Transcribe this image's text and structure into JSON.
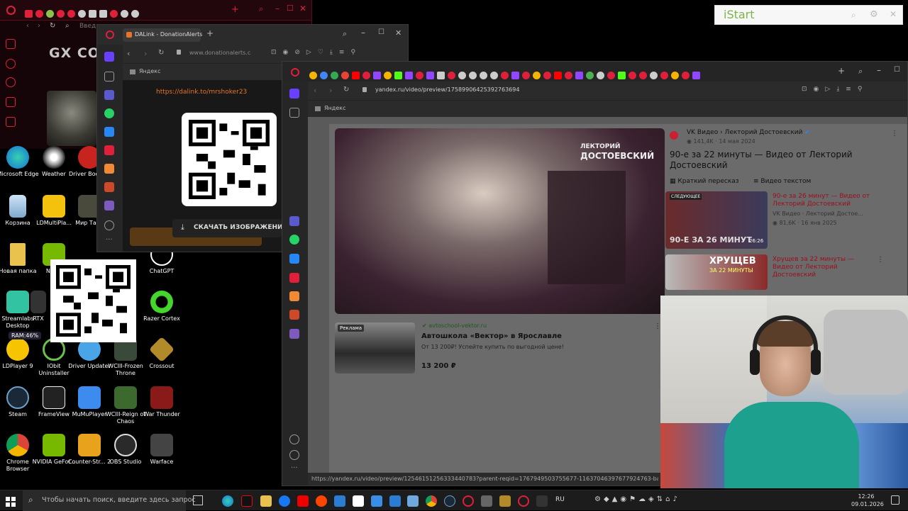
{
  "colors": {
    "opera_red": "#e0203a",
    "accent_orange": "#e8742a",
    "brand_red": "#cc1f2f",
    "vk_blue": "#2787f5"
  },
  "gx_window": {
    "title_text": "GX CO",
    "address_placeholder": "Введ"
  },
  "istart": {
    "label": "iStart"
  },
  "desktop_icons": [
    {
      "label": "Microsoft Edge"
    },
    {
      "label": "Weather"
    },
    {
      "label": "Driver Booster"
    },
    {
      "label": "Корзина"
    },
    {
      "label": "LDMultiPla..."
    },
    {
      "label": "Мир Танк"
    },
    {
      "label": "Новая папка"
    },
    {
      "label": "NVIDI"
    },
    {
      "label": "ChatGPT"
    },
    {
      "label": "Streamlabs Desktop"
    },
    {
      "label": "RTX"
    },
    {
      "label": "Razer Cortex"
    },
    {
      "label": "LDPlayer 9"
    },
    {
      "label": "IObit Uninstaller"
    },
    {
      "label": "Driver Updater"
    },
    {
      "label": "WCIII-Frozen Throne"
    },
    {
      "label": "Crossout"
    },
    {
      "label": "Steam"
    },
    {
      "label": "FrameView"
    },
    {
      "label": "MuMuPlayer"
    },
    {
      "label": "WCIII-Reign of Chaos"
    },
    {
      "label": "War Thunder"
    },
    {
      "label": "Chrome Browser"
    },
    {
      "label": "NVIDIA GeFor..."
    },
    {
      "label": "Counter-Str... 2"
    },
    {
      "label": "OBS Studio"
    },
    {
      "label": "Warface"
    }
  ],
  "ram_badge": "RAM:46%",
  "donation_window": {
    "tab_title": "DALink - DonationAlerts",
    "url": "www.donationalerts.c",
    "bookmark": "Яндекс",
    "link": "https://dalink.to/mrshoker23",
    "download_button": "СКАЧАТЬ ИЗОБРАЖЕНИЕ"
  },
  "main_browser": {
    "url": "yandex.ru/video/preview/17589906425392763694",
    "bookmark": "Яндекс",
    "status_url": "https://yandex.ru/video/preview/12546151256333440783?parent-reqid=1767949503755677-11637046397677924763-balancer-l",
    "video": {
      "watermark_channel": "ЛЕКТОРИЙ",
      "watermark_name": "ДОСТОЕВСКИЙ",
      "source": "VK Видео",
      "channel": "Лекторий Достоевский",
      "views": "141,4K",
      "date": "14 мая 2024",
      "title": "90-е за 22 минуты — Видео от Лекторий Достоевский",
      "chip_summary": "Краткий пересказ",
      "chip_text": "Видео текстом"
    },
    "related": [
      {
        "title": "90-е за 26 минут — Видео от Лекторий Достоевский",
        "source": "VK Видео · Лекторий Достое...",
        "views": "81,6K",
        "date": "16 янв 2025",
        "duration": "26:26",
        "thumb_text": "90-Е ЗА 26 МИНУТ",
        "thumb_tag": "СЛЕДУЮЩЕЕ"
      },
      {
        "title": "Хрущев за 22 минуты — Видео от Лекторий Достоевский",
        "thumb_text": "ХРУЩЕВ",
        "thumb_sub": "ЗА 22 МИНУТЫ"
      }
    ],
    "ad": {
      "domain": "avtoschool-vektor.ru",
      "badge": "Реклама",
      "title": "Автошкола «Вектор» в Ярославле",
      "desc": "От 13 200₽! Успейте купить по выгодной цене!",
      "price": "13 200 ₽"
    }
  },
  "taskbar": {
    "search_placeholder": "Чтобы начать поиск, введите здесь запрос",
    "lang": "RU",
    "time": "12:26",
    "date": "09.01.2026"
  }
}
